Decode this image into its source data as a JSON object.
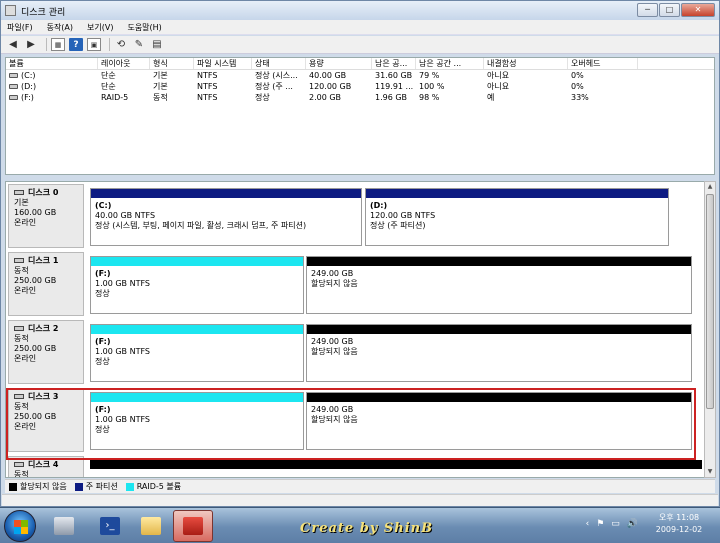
{
  "window": {
    "title": "디스크 관리",
    "controls": [
      "─",
      "□",
      "✕"
    ]
  },
  "menu": [
    "파일(F)",
    "동작(A)",
    "보기(V)",
    "도움말(H)"
  ],
  "toolbar": [
    "◀",
    "▶",
    "▦",
    "?",
    "▣",
    "⟲",
    "✎",
    "▤"
  ],
  "volumes": {
    "columns": [
      "볼륨",
      "레이아웃",
      "형식",
      "파일 시스템",
      "상태",
      "용량",
      "남은 공...",
      "남은 공간 ...",
      "내결함성",
      "오버헤드"
    ],
    "rows": [
      [
        "(C:)",
        "단순",
        "기본",
        "NTFS",
        "정상 (시스...",
        "40.00 GB",
        "31.60 GB",
        "79 %",
        "아니요",
        "0%"
      ],
      [
        "(D:)",
        "단순",
        "기본",
        "NTFS",
        "정상 (주 ...",
        "120.00 GB",
        "119.91 ...",
        "100 %",
        "아니요",
        "0%"
      ],
      [
        "(F:)",
        "RAID-5",
        "동적",
        "NTFS",
        "정상",
        "2.00 GB",
        "1.96 GB",
        "98 %",
        "예",
        "33%"
      ]
    ]
  },
  "disks": [
    {
      "name": "디스크 0",
      "type": "기본",
      "size": "160.00 GB",
      "status": "온라인",
      "partitions": [
        {
          "name": "(C:)",
          "size": "40.00 GB NTFS",
          "status": "정상 (시스템, 부팅, 페이지 파일, 활성, 크래시 덤프, 주 파티션)",
          "bar": "#0d1b82"
        },
        {
          "name": "(D:)",
          "size": "120.00 GB NTFS",
          "status": "정상 (주 파티션)",
          "bar": "#0d1b82"
        }
      ]
    },
    {
      "name": "디스크 1",
      "type": "동적",
      "size": "250.00 GB",
      "status": "온라인",
      "partitions": [
        {
          "name": "(F:)",
          "size": "1.00 GB NTFS",
          "status": "정상",
          "bar": "#1ce6f0"
        },
        {
          "name": "",
          "size": "249.00 GB",
          "status": "할당되지 않음",
          "bar": "#000000"
        }
      ]
    },
    {
      "name": "디스크 2",
      "type": "동적",
      "size": "250.00 GB",
      "status": "온라인",
      "partitions": [
        {
          "name": "(F:)",
          "size": "1.00 GB NTFS",
          "status": "정상",
          "bar": "#1ce6f0"
        },
        {
          "name": "",
          "size": "249.00 GB",
          "status": "할당되지 않음",
          "bar": "#000000"
        }
      ]
    },
    {
      "name": "디스크 3",
      "type": "동적",
      "size": "250.00 GB",
      "status": "온라인",
      "partitions": [
        {
          "name": "(F:)",
          "size": "1.00 GB NTFS",
          "status": "정상",
          "bar": "#1ce6f0"
        },
        {
          "name": "",
          "size": "249.00 GB",
          "status": "할당되지 않음",
          "bar": "#000000"
        }
      ]
    },
    {
      "name": "디스크 4",
      "type": "동적",
      "size": "",
      "status": "",
      "partitions": []
    }
  ],
  "legend": [
    {
      "label": "할당되지 않음",
      "color": "#000000"
    },
    {
      "label": "주 파티션",
      "color": "#0d1b82"
    },
    {
      "label": "RAID-5 볼륨",
      "color": "#1ce6f0"
    }
  ],
  "taskbar": {
    "credit": "Create by ShinB",
    "clock_time": "오후 11:08",
    "clock_date": "2009-12-02",
    "tray_icons": [
      "‹",
      "⚑",
      "▭",
      "🔊"
    ]
  }
}
